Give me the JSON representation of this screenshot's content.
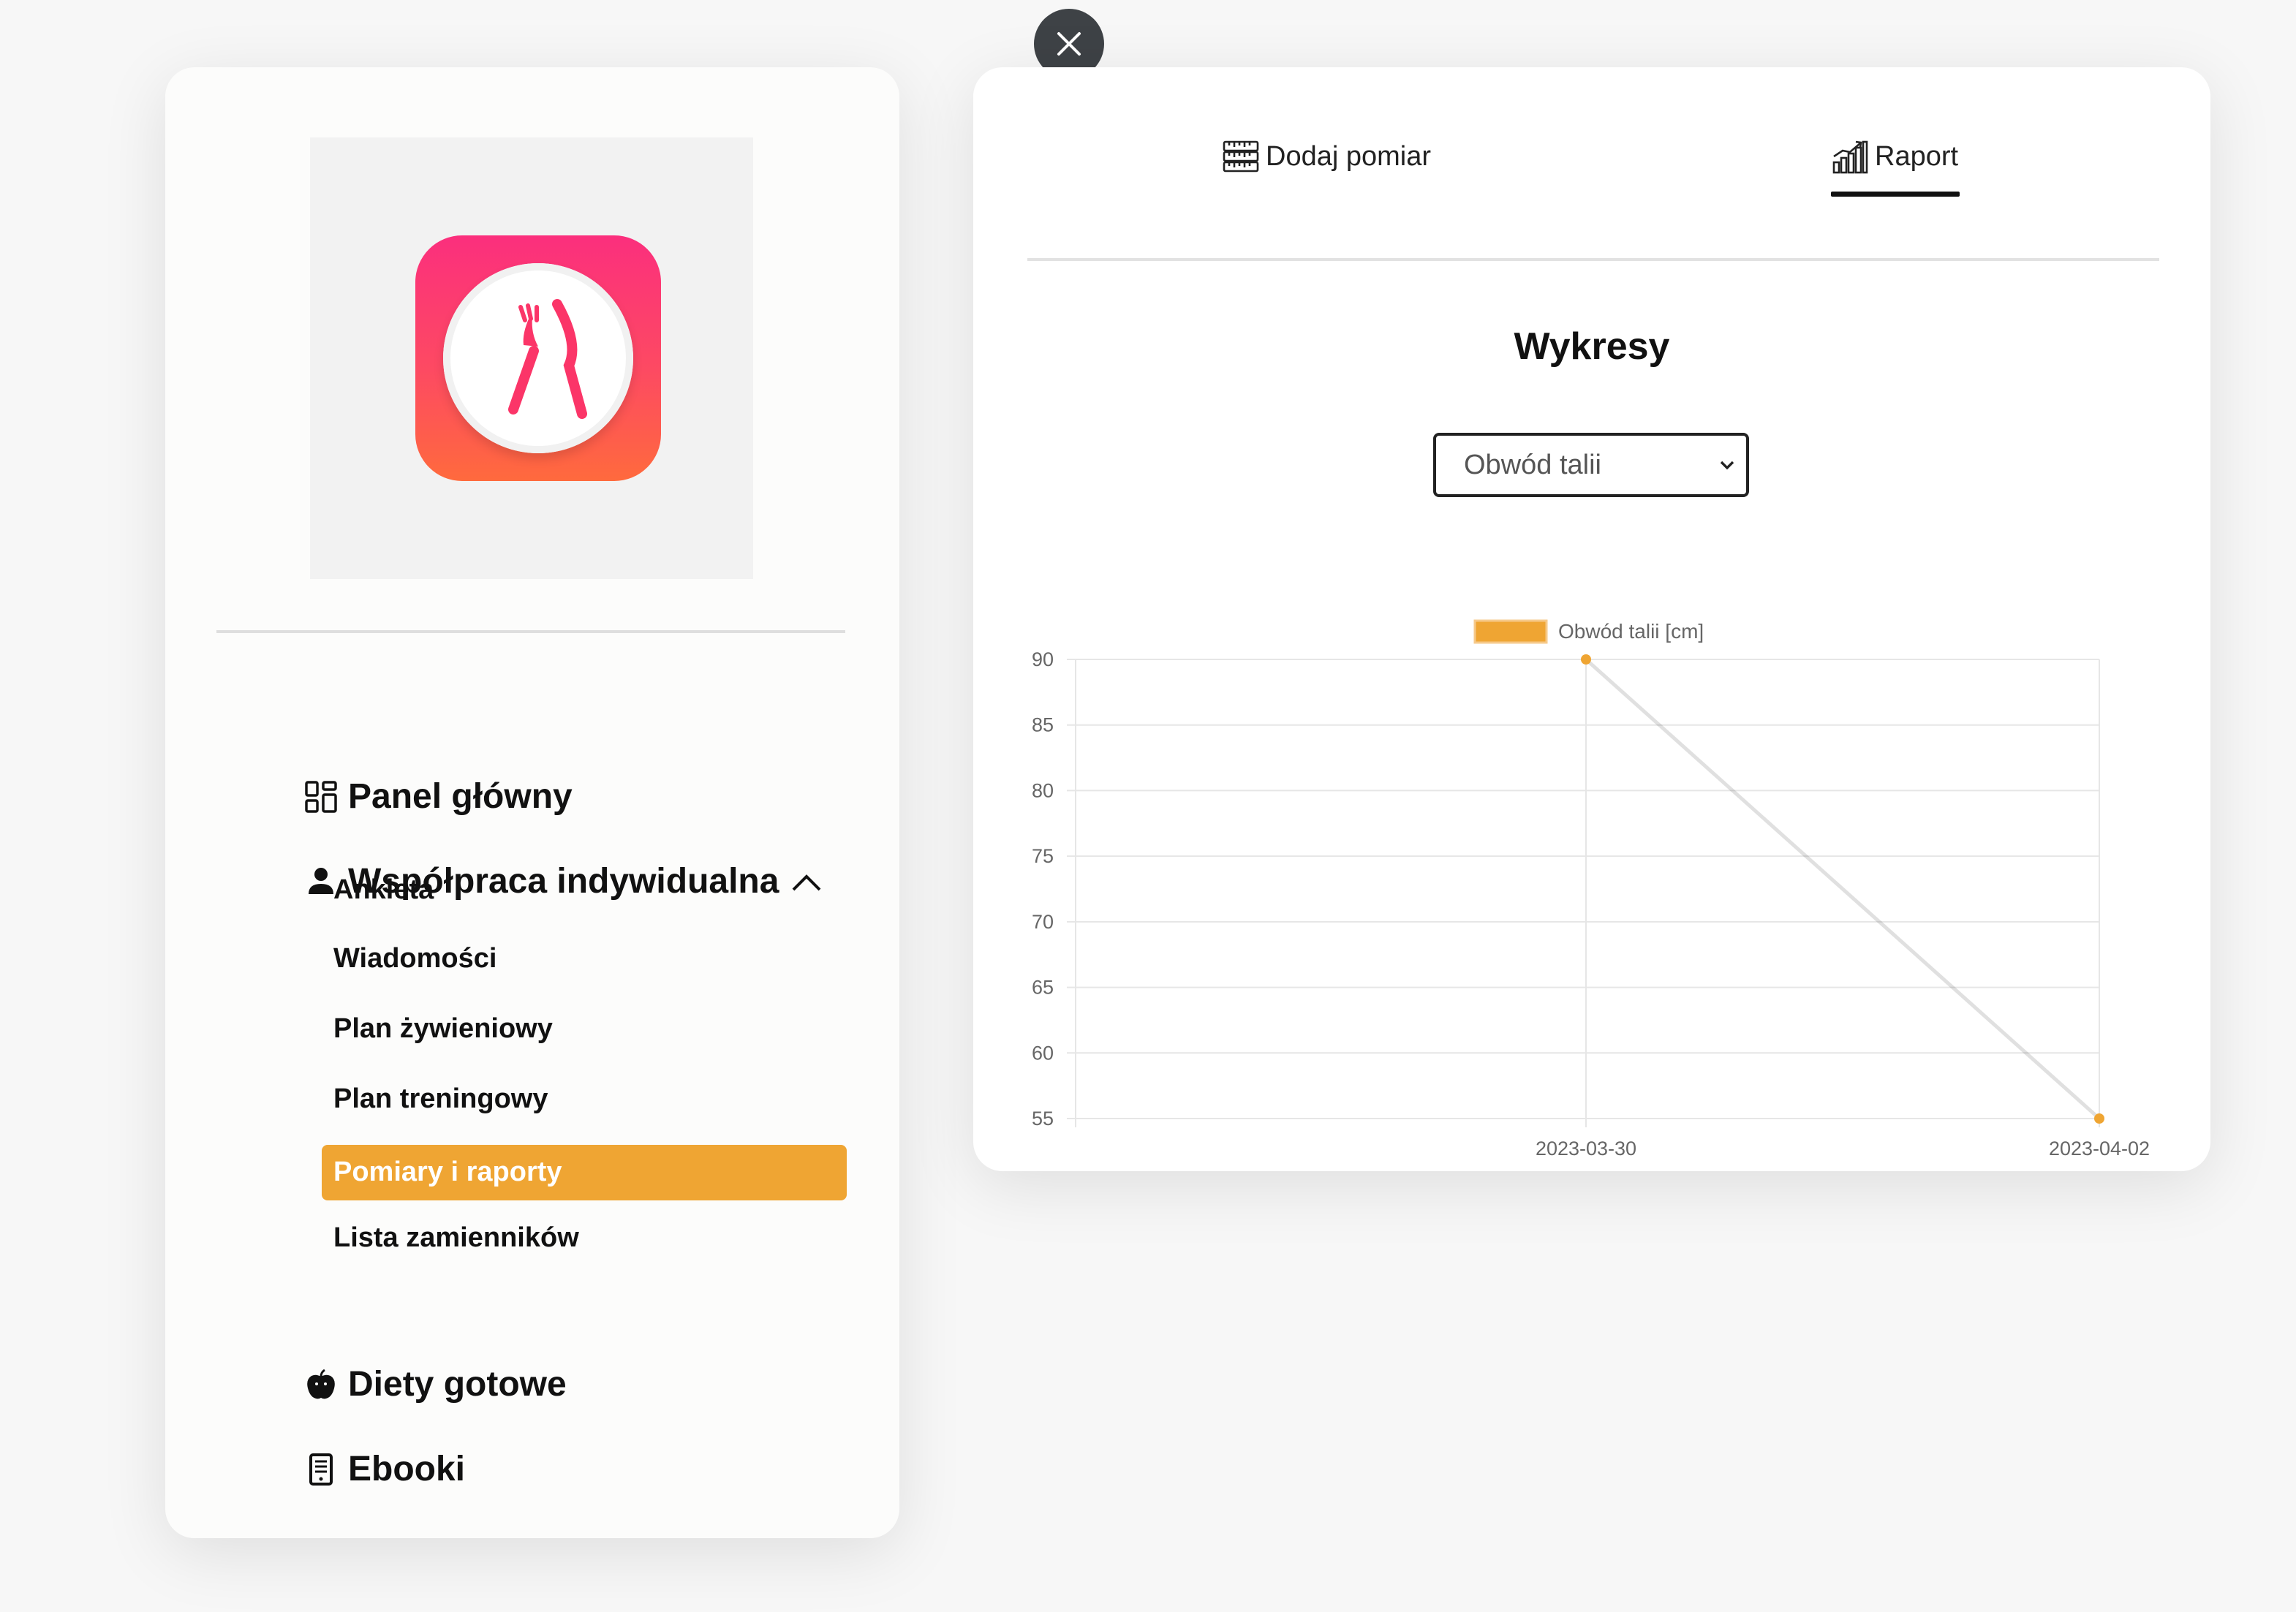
{
  "sidebar": {
    "nav": [
      {
        "label": "Panel główny",
        "icon": "dashboard-grid-icon"
      },
      {
        "label": "Współpraca indywidualna",
        "icon": "person-icon",
        "expanded": true
      },
      {
        "label": "Diety gotowe",
        "icon": "apple-icon"
      },
      {
        "label": "Ebooki",
        "icon": "ebook-icon"
      }
    ],
    "subnav": [
      {
        "label": "Ankieta"
      },
      {
        "label": "Wiadomości"
      },
      {
        "label": "Plan żywieniowy"
      },
      {
        "label": "Plan treningowy"
      },
      {
        "label": "Pomiary i raporty",
        "active": true
      },
      {
        "label": "Lista zamienników"
      }
    ]
  },
  "panel": {
    "tabs": [
      {
        "label": "Dodaj pomiar",
        "icon": "measuring-tape-icon",
        "active": false
      },
      {
        "label": "Raport",
        "icon": "bar-chart-icon",
        "active": true
      }
    ],
    "heading": "Wykresy",
    "select": {
      "value": "Obwód talii"
    }
  },
  "colors": {
    "accent": "#efa533",
    "close_button": "#3e4246",
    "logo_pink": "#fb2f7d",
    "logo_orange": "#ff6a3d"
  },
  "chart_data": {
    "type": "line",
    "categories": [
      "2023-03-30",
      "2023-04-02"
    ],
    "series": [
      {
        "name": "Obwód talii [cm]",
        "values": [
          90,
          55
        ],
        "color": "#efa533"
      }
    ],
    "ylim": [
      55,
      90
    ],
    "yticks": [
      90,
      85,
      80,
      75,
      70,
      65,
      60,
      55
    ],
    "grid": true,
    "legend": "top"
  }
}
